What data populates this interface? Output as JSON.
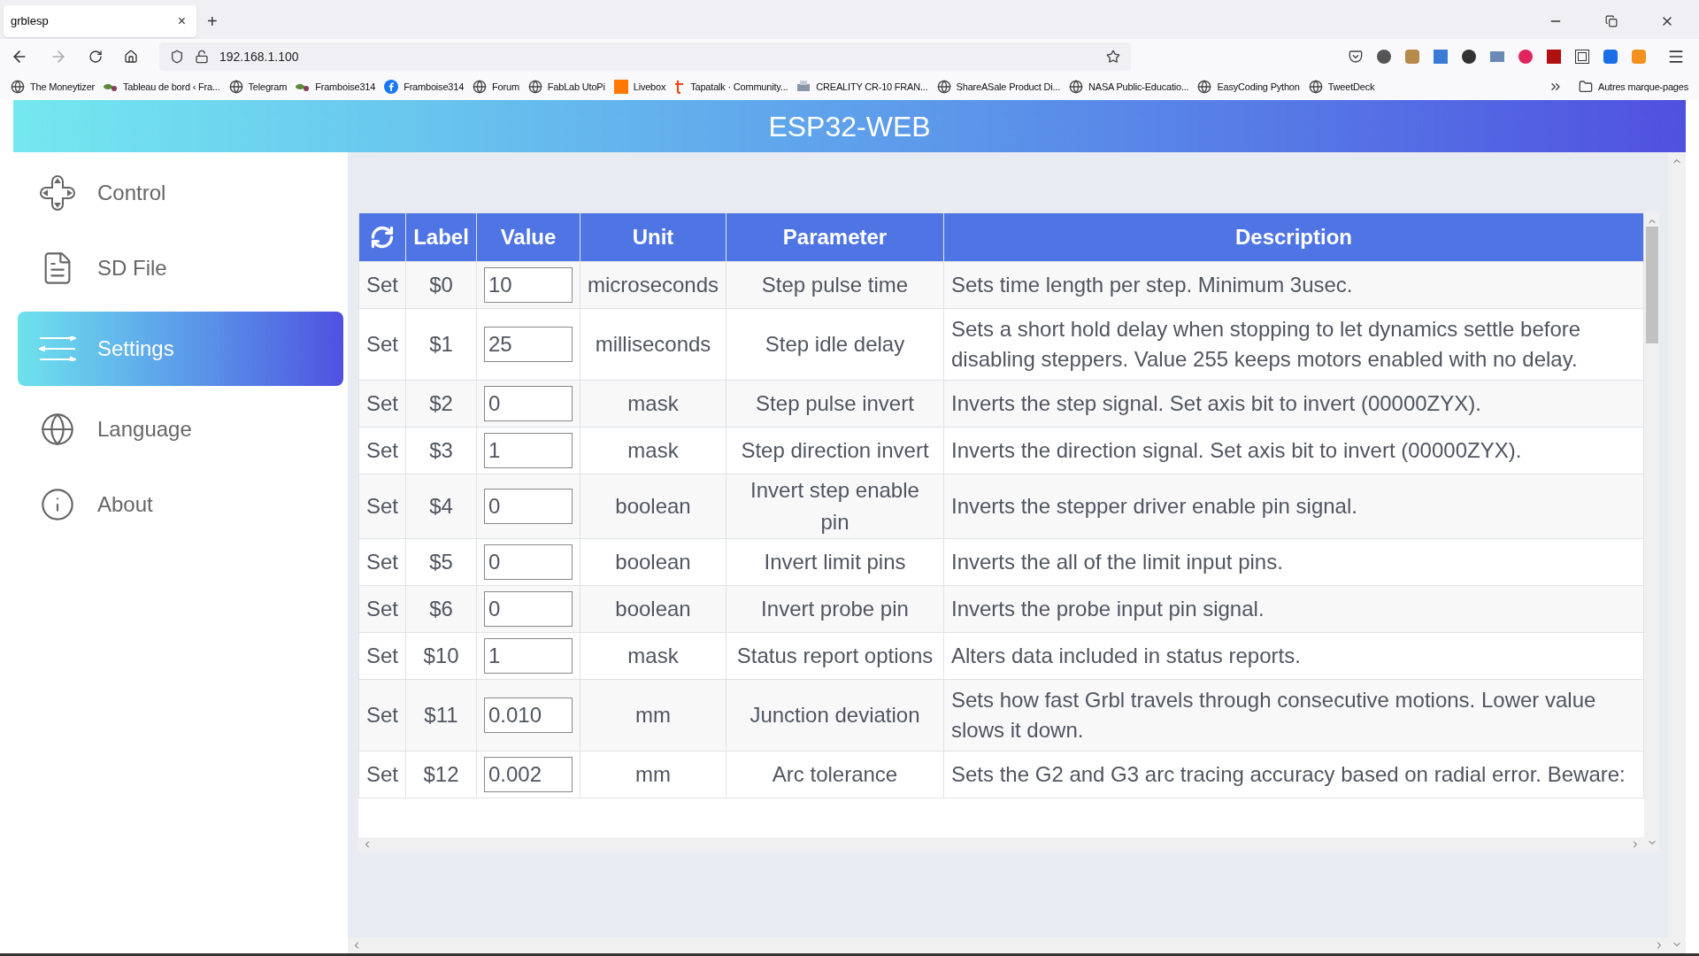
{
  "browser": {
    "tab": {
      "title": "grblesp",
      "close": "×"
    },
    "new_tab": "+",
    "address": "192.168.1.100",
    "bookmarks": [
      {
        "kind": "globe",
        "label": "The Moneytizer"
      },
      {
        "kind": "leaf",
        "label": "Tableau de bord ‹ Fra..."
      },
      {
        "kind": "globe",
        "label": "Telegram"
      },
      {
        "kind": "leaf",
        "label": "Framboise314"
      },
      {
        "kind": "facebook",
        "label": "Framboise314"
      },
      {
        "kind": "globe",
        "label": "Forum"
      },
      {
        "kind": "globe",
        "label": "FabLab UtoPi"
      },
      {
        "kind": "square",
        "label": "Livebox"
      },
      {
        "kind": "letter",
        "label": "Tapatalk · Community..."
      },
      {
        "kind": "printer",
        "label": "CREALITY CR-10 FRAN..."
      },
      {
        "kind": "globe",
        "label": "ShareASale Product Di..."
      },
      {
        "kind": "globe",
        "label": "NASA Public-Educatio..."
      },
      {
        "kind": "globe",
        "label": "EasyCoding Python"
      },
      {
        "kind": "globe",
        "label": "TweetDeck"
      }
    ],
    "other_bookmarks": "Autres marque-pages"
  },
  "app": {
    "title": "ESP32-WEB",
    "sidebar": [
      {
        "kind": "control",
        "label": "Control",
        "selected": false
      },
      {
        "kind": "file",
        "label": "SD File",
        "selected": false
      },
      {
        "kind": "settings",
        "label": "Settings",
        "selected": true
      },
      {
        "kind": "language",
        "label": "Language",
        "selected": false
      },
      {
        "kind": "about",
        "label": "About",
        "selected": false
      }
    ],
    "table": {
      "columns": [
        "Label",
        "Value",
        "Unit",
        "Parameter",
        "Description"
      ],
      "rows": [
        {
          "action": "Set",
          "label": "$0",
          "value": "10",
          "unit": "microseconds",
          "parameter": "Step pulse time",
          "description": "Sets time length per step. Minimum 3usec."
        },
        {
          "action": "Set",
          "label": "$1",
          "value": "25",
          "unit": "milliseconds",
          "parameter": "Step idle delay",
          "description": "Sets a short hold delay when stopping to let dynamics settle before disabling steppers. Value 255 keeps motors enabled with no delay."
        },
        {
          "action": "Set",
          "label": "$2",
          "value": "0",
          "unit": "mask",
          "parameter": "Step pulse invert",
          "description": "Inverts the step signal. Set axis bit to invert (00000ZYX)."
        },
        {
          "action": "Set",
          "label": "$3",
          "value": "1",
          "unit": "mask",
          "parameter": "Step direction invert",
          "description": "Inverts the direction signal. Set axis bit to invert (00000ZYX)."
        },
        {
          "action": "Set",
          "label": "$4",
          "value": "0",
          "unit": "boolean",
          "parameter": "Invert step enable pin",
          "description": "Inverts the stepper driver enable pin signal."
        },
        {
          "action": "Set",
          "label": "$5",
          "value": "0",
          "unit": "boolean",
          "parameter": "Invert limit pins",
          "description": "Inverts the all of the limit input pins."
        },
        {
          "action": "Set",
          "label": "$6",
          "value": "0",
          "unit": "boolean",
          "parameter": "Invert probe pin",
          "description": "Inverts the probe input pin signal."
        },
        {
          "action": "Set",
          "label": "$10",
          "value": "1",
          "unit": "mask",
          "parameter": "Status report options",
          "description": "Alters data included in status reports."
        },
        {
          "action": "Set",
          "label": "$11",
          "value": "0.010",
          "unit": "mm",
          "parameter": "Junction deviation",
          "description": "Sets how fast Grbl travels through consecutive motions. Lower value slows it down."
        },
        {
          "action": "Set",
          "label": "$12",
          "value": "0.002",
          "unit": "mm",
          "parameter": "Arc tolerance",
          "description": "Sets the G2 and G3 arc tracing accuracy based on radial error. Beware:"
        }
      ]
    }
  }
}
